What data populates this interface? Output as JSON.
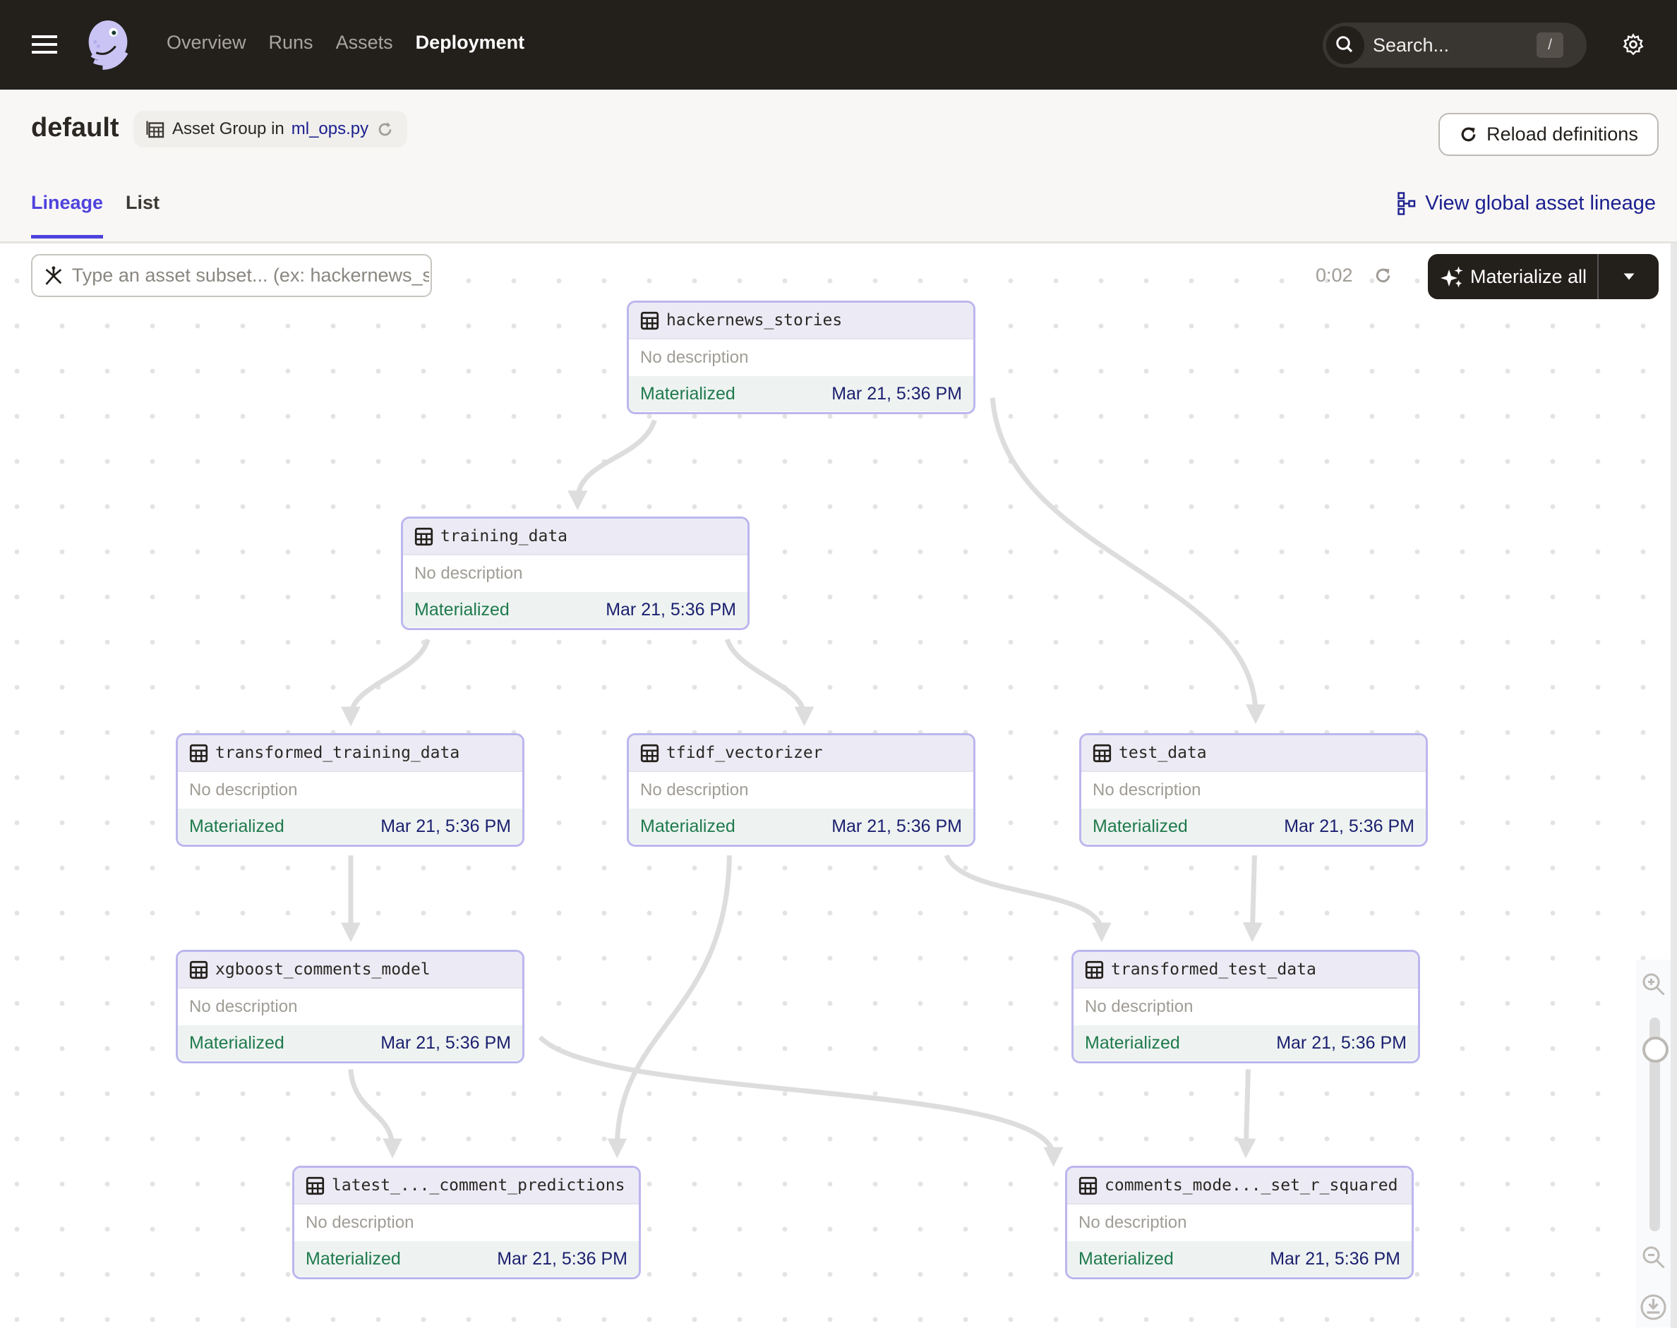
{
  "topbar": {
    "nav": [
      "Overview",
      "Runs",
      "Assets",
      "Deployment"
    ],
    "active_nav": "Deployment",
    "search_placeholder": "Search...",
    "search_shortcut": "/"
  },
  "header": {
    "title": "default",
    "chip_prefix": "Asset Group in",
    "chip_location": "ml_ops.py",
    "reload_label": "Reload definitions",
    "tabs": [
      "Lineage",
      "List"
    ],
    "active_tab": "Lineage",
    "global_lineage_label": "View global asset lineage"
  },
  "toolbar": {
    "filter_placeholder": "Type an asset subset... (ex: hackernews_stories+)",
    "timer": "0:02",
    "materialize_label": "Materialize all"
  },
  "colors": {
    "accent": "#4f43dd",
    "node_border": "#bcb6ee",
    "materialized": "#1f7a4d",
    "topbar": "#231f1b"
  },
  "nodes": [
    {
      "name": "hackernews_stories",
      "description": "No description",
      "status": "Materialized",
      "timestamp": "Mar 21, 5:36 PM"
    },
    {
      "name": "training_data",
      "description": "No description",
      "status": "Materialized",
      "timestamp": "Mar 21, 5:36 PM"
    },
    {
      "name": "transformed_training_data",
      "description": "No description",
      "status": "Materialized",
      "timestamp": "Mar 21, 5:36 PM"
    },
    {
      "name": "tfidf_vectorizer",
      "description": "No description",
      "status": "Materialized",
      "timestamp": "Mar 21, 5:36 PM"
    },
    {
      "name": "test_data",
      "description": "No description",
      "status": "Materialized",
      "timestamp": "Mar 21, 5:36 PM"
    },
    {
      "name": "xgboost_comments_model",
      "description": "No description",
      "status": "Materialized",
      "timestamp": "Mar 21, 5:36 PM"
    },
    {
      "name": "transformed_test_data",
      "description": "No description",
      "status": "Materialized",
      "timestamp": "Mar 21, 5:36 PM"
    },
    {
      "name": "latest_..._comment_predictions",
      "description": "No description",
      "status": "Materialized",
      "timestamp": "Mar 21, 5:36 PM"
    },
    {
      "name": "comments_mode..._set_r_squared",
      "description": "No description",
      "status": "Materialized",
      "timestamp": "Mar 21, 5:36 PM"
    }
  ],
  "edges": [
    [
      "hackernews_stories",
      "training_data"
    ],
    [
      "hackernews_stories",
      "test_data"
    ],
    [
      "training_data",
      "transformed_training_data"
    ],
    [
      "training_data",
      "tfidf_vectorizer"
    ],
    [
      "transformed_training_data",
      "xgboost_comments_model"
    ],
    [
      "tfidf_vectorizer",
      "latest_..._comment_predictions"
    ],
    [
      "tfidf_vectorizer",
      "transformed_test_data"
    ],
    [
      "test_data",
      "transformed_test_data"
    ],
    [
      "xgboost_comments_model",
      "latest_..._comment_predictions"
    ],
    [
      "xgboost_comments_model",
      "comments_mode..._set_r_squared"
    ],
    [
      "transformed_test_data",
      "comments_mode..._set_r_squared"
    ]
  ]
}
